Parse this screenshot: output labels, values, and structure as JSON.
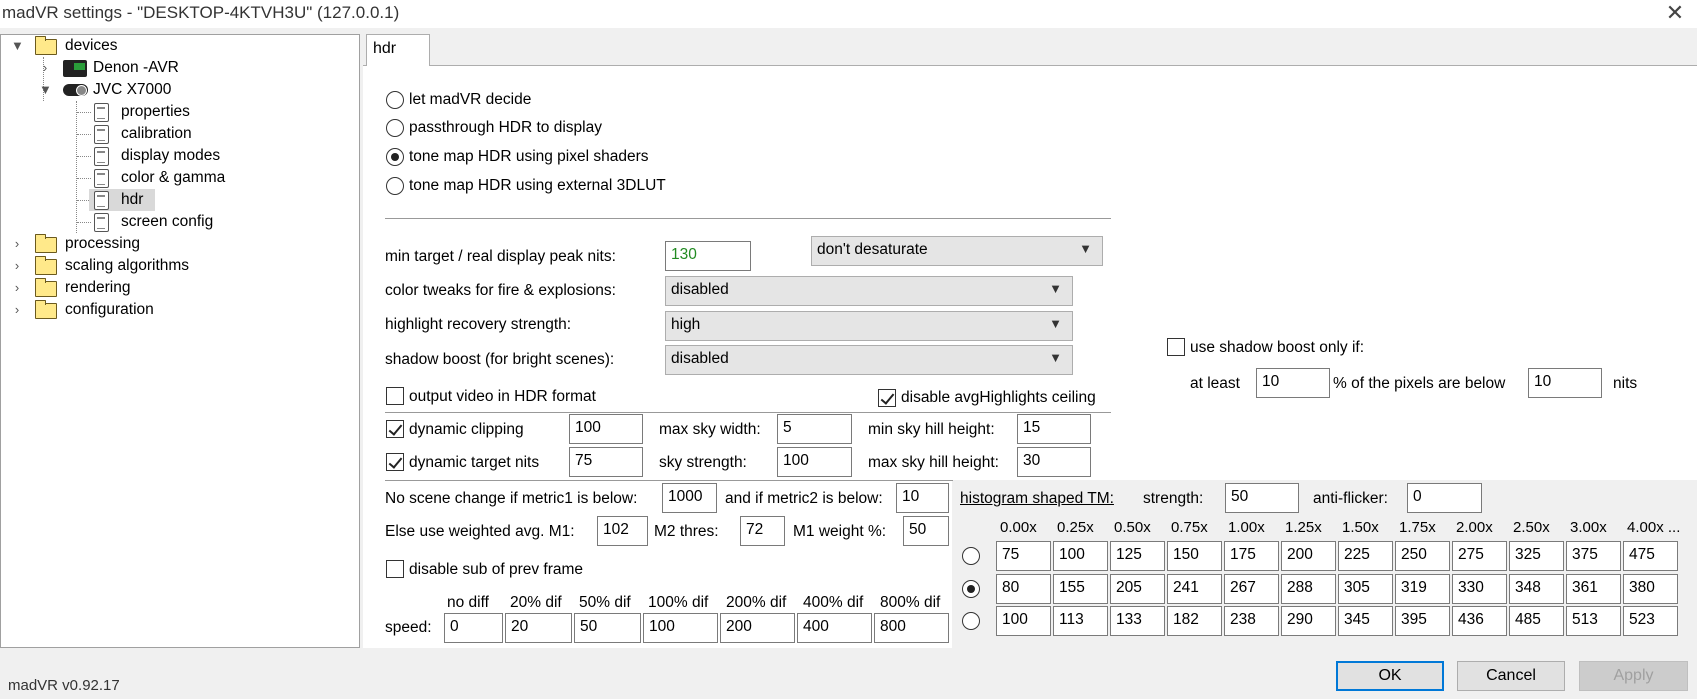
{
  "window": {
    "title": "madVR settings - \"DESKTOP-4KTVH3U\" (127.0.0.1)",
    "close_glyph": "✕"
  },
  "tree": {
    "devices": "devices",
    "denon": "Denon -AVR",
    "jvc": "JVC X7000",
    "properties": "properties",
    "calibration": "calibration",
    "display_modes": "display modes",
    "color_gamma": "color & gamma",
    "hdr": "hdr",
    "screen_config": "screen config",
    "processing": "processing",
    "scaling": "scaling algorithms",
    "rendering": "rendering",
    "configuration": "configuration"
  },
  "tab": {
    "label": "hdr"
  },
  "hdr_mode": {
    "options": [
      "let madVR decide",
      "passthrough HDR to display",
      "tone map HDR using pixel shaders",
      "tone map HDR using external 3DLUT"
    ],
    "selected": 2
  },
  "settings": {
    "peak_nits_label": "min target / real display peak nits:",
    "peak_nits_value": "130",
    "desaturate_value": "don't desaturate",
    "fire_label": "color tweaks for fire & explosions:",
    "fire_value": "disabled",
    "highlight_label": "highlight recovery strength:",
    "highlight_value": "high",
    "shadow_label": "shadow boost (for bright scenes):",
    "shadow_value": "disabled",
    "output_hdr_label": "output video in HDR format",
    "disable_avg_label": "disable avgHighlights ceiling",
    "dyn_clip_label": "dynamic clipping",
    "dyn_clip_value": "100",
    "max_sky_width_label": "max sky width:",
    "max_sky_width_value": "5",
    "min_sky_hill_label": "min sky hill height:",
    "min_sky_hill_value": "15",
    "dyn_target_label": "dynamic target nits",
    "dyn_target_value": "75",
    "sky_strength_label": "sky strength:",
    "sky_strength_value": "100",
    "max_sky_hill_label": "max sky hill height:",
    "max_sky_hill_value": "30"
  },
  "shadow_cond": {
    "label": "use shadow boost only if:",
    "at_least": "at least",
    "pct_value": "10",
    "pct_text": "% of the pixels are below",
    "nits_value": "10",
    "nits": "nits"
  },
  "scene": {
    "metric1_label": "No scene change if metric1 is below:",
    "metric1_value": "1000",
    "metric2_label": "and if metric2 is below:",
    "metric2_value": "10",
    "else_label": "Else use weighted avg. M1:",
    "m1_value": "102",
    "m2_label": "M2 thres:",
    "m2_value": "72",
    "m1w_label": "M1 weight %:",
    "m1w_value": "50",
    "disable_sub_label": "disable sub of prev frame",
    "speed_label": "speed:",
    "speed_headers": [
      "no diff",
      "20% dif",
      "50% dif",
      "100% dif",
      "200% dif",
      "400% dif",
      "800% dif"
    ],
    "speed_values": [
      "0",
      "20",
      "50",
      "100",
      "200",
      "400",
      "800"
    ]
  },
  "histogram": {
    "label": "histogram shaped TM:",
    "strength_label": "strength:",
    "strength_value": "50",
    "antiflicker_label": "anti-flicker:",
    "antiflicker_value": "0",
    "headers": [
      "0.00x",
      "0.25x",
      "0.50x",
      "0.75x",
      "1.00x",
      "1.25x",
      "1.50x",
      "1.75x",
      "2.00x",
      "2.50x",
      "3.00x",
      "4.00x ..."
    ],
    "rows": [
      [
        "75",
        "100",
        "125",
        "150",
        "175",
        "200",
        "225",
        "250",
        "275",
        "325",
        "375",
        "475"
      ],
      [
        "80",
        "155",
        "205",
        "241",
        "267",
        "288",
        "305",
        "319",
        "330",
        "348",
        "361",
        "380"
      ],
      [
        "100",
        "113",
        "133",
        "182",
        "238",
        "290",
        "345",
        "395",
        "436",
        "485",
        "513",
        "523"
      ]
    ],
    "selected_row": 1
  },
  "footer": {
    "version": "madVR v0.92.17",
    "ok": "OK",
    "cancel": "Cancel",
    "apply": "Apply"
  }
}
